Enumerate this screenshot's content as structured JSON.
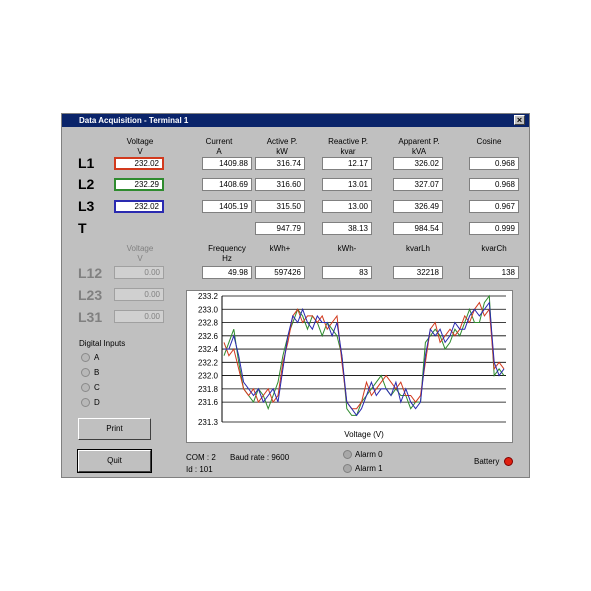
{
  "window": {
    "title": "Data Acquisition - Terminal 1",
    "close_glyph": "×"
  },
  "columns": [
    {
      "name": "Voltage",
      "unit": "V"
    },
    {
      "name": "Current",
      "unit": "A"
    },
    {
      "name": "Active P.",
      "unit": "kW"
    },
    {
      "name": "Reactive P.",
      "unit": "kvar"
    },
    {
      "name": "Apparent P.",
      "unit": "kVA"
    },
    {
      "name": "Cosine",
      "unit": ""
    }
  ],
  "phases": [
    {
      "label": "L1",
      "voltage": "232.02",
      "current": "1409.88",
      "active": "316.74",
      "reactive": "12.17",
      "apparent": "326.02",
      "cosine": "0.968",
      "color": "#d23a1e"
    },
    {
      "label": "L2",
      "voltage": "232.29",
      "current": "1408.69",
      "active": "316.60",
      "reactive": "13.01",
      "apparent": "327.07",
      "cosine": "0.968",
      "color": "#2e8b2e"
    },
    {
      "label": "L3",
      "voltage": "232.02",
      "current": "1405.19",
      "active": "315.50",
      "reactive": "13.00",
      "apparent": "326.49",
      "cosine": "0.967",
      "color": "#2a2ab0"
    }
  ],
  "total": {
    "label": "T",
    "active": "947.79",
    "reactive": "38.13",
    "apparent": "984.54",
    "cosine": "0.999"
  },
  "line_voltage": {
    "header": {
      "name": "Voltage",
      "unit": "V"
    },
    "rows": [
      {
        "label": "L12",
        "value": "0.00"
      },
      {
        "label": "L23",
        "value": "0.00"
      },
      {
        "label": "L31",
        "value": "0.00"
      }
    ]
  },
  "energy": {
    "headers": [
      {
        "name": "Frequency",
        "unit": "Hz"
      },
      {
        "name": "kWh+",
        "unit": ""
      },
      {
        "name": "kWh-",
        "unit": ""
      },
      {
        "name": "kvarLh",
        "unit": ""
      },
      {
        "name": "kvarCh",
        "unit": ""
      }
    ],
    "values": [
      "49.98",
      "597426",
      "83",
      "32218",
      "138"
    ]
  },
  "digital_inputs": {
    "title": "Digital Inputs",
    "items": [
      "A",
      "B",
      "C",
      "D"
    ]
  },
  "buttons": {
    "print": "Print",
    "quit": "Quit"
  },
  "status": {
    "com": "COM : 2",
    "id": "Id : 101",
    "baud": "Baud rate : 9600",
    "battery": "Battery",
    "battery_color": "#e02010"
  },
  "alarms": [
    "Alarm 0",
    "Alarm 1"
  ],
  "chart_data": {
    "type": "line",
    "xlabel": "Voltage (V)",
    "ylim": [
      231.3,
      233.2
    ],
    "yticks": [
      "233.2",
      "233.0",
      "232.8",
      "232.6",
      "232.4",
      "232.2",
      "232.0",
      "231.8",
      "231.6",
      "231.3"
    ],
    "grid": true,
    "series": [
      {
        "color": "#2e8b2e",
        "values": [
          232.3,
          232.5,
          232.7,
          232.2,
          231.8,
          231.7,
          231.6,
          231.8,
          231.7,
          231.5,
          231.7,
          231.9,
          232.3,
          232.6,
          232.8,
          233.0,
          232.9,
          232.7,
          232.9,
          232.8,
          232.6,
          232.8,
          232.7,
          232.6,
          232.3,
          231.5,
          231.4,
          231.4,
          231.6,
          231.7,
          231.8,
          231.9,
          232.0,
          231.8,
          231.7,
          231.8,
          231.7,
          231.7,
          231.5,
          231.6,
          231.6,
          232.5,
          232.6,
          232.7,
          232.6,
          232.4,
          232.5,
          232.7,
          232.6,
          232.8,
          233.0,
          232.8,
          232.8,
          233.1,
          233.2,
          232.0,
          232.1,
          232.0
        ]
      },
      {
        "color": "#d23a1e",
        "values": [
          232.5,
          232.3,
          232.4,
          232.1,
          231.8,
          231.7,
          231.8,
          231.6,
          231.7,
          231.8,
          231.6,
          231.7,
          232.2,
          232.5,
          232.9,
          233.0,
          232.8,
          232.9,
          232.9,
          232.8,
          232.9,
          232.7,
          232.8,
          232.9,
          232.2,
          231.6,
          231.5,
          231.5,
          231.6,
          231.9,
          231.7,
          231.8,
          231.9,
          232.0,
          231.9,
          231.8,
          231.9,
          231.7,
          231.7,
          231.6,
          231.7,
          232.2,
          232.7,
          232.8,
          232.5,
          232.6,
          232.7,
          232.6,
          232.7,
          232.9,
          232.8,
          233.0,
          233.1,
          232.9,
          233.0,
          232.1,
          232.2,
          232.1
        ]
      },
      {
        "color": "#2a2ab0",
        "values": [
          232.4,
          232.4,
          232.6,
          232.3,
          231.9,
          231.8,
          231.7,
          231.8,
          231.6,
          231.7,
          231.8,
          231.6,
          232.1,
          232.6,
          232.9,
          232.8,
          233.0,
          232.8,
          232.7,
          232.9,
          232.8,
          232.8,
          232.6,
          232.8,
          232.3,
          231.6,
          231.5,
          231.4,
          231.5,
          231.7,
          231.9,
          231.7,
          231.8,
          231.8,
          231.7,
          231.9,
          231.6,
          231.8,
          231.6,
          231.5,
          231.6,
          232.3,
          232.7,
          232.6,
          232.7,
          232.5,
          232.6,
          232.8,
          232.7,
          232.7,
          232.9,
          233.0,
          232.9,
          233.0,
          233.1,
          232.2,
          232.0,
          232.1
        ]
      }
    ]
  }
}
